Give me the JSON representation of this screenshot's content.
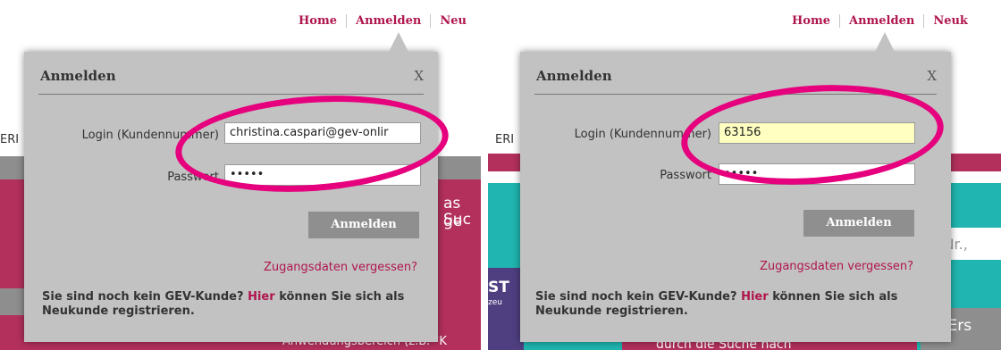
{
  "colors": {
    "accent": "#b0164e",
    "highlight_ring": "#e6007e",
    "dialog_bg": "#c2c2c2",
    "button_bg": "#8f8f8f"
  },
  "left": {
    "nav": [
      "Home",
      "Anmelden",
      "Neu"
    ],
    "bg_text": {
      "edge": "ERI",
      "s1": "as ge",
      "s2": "Suc",
      "bottom": "Anwendungsbereich (z.B. \"K"
    },
    "dialog": {
      "title": "Anmelden",
      "close_label": "X",
      "login_label": "Login (Kundennummer)",
      "login_value": "christina.caspari@gev-onlir",
      "password_label": "Passwort",
      "password_value": "•••••",
      "submit_label": "Anmelden",
      "forgot_label": "Zugangsdaten vergessen?",
      "note_prefix": "Sie sind noch kein GEV-Kunde?",
      "note_link": "Hier",
      "note_suffix": "können Sie sich als Neukunde registrieren."
    }
  },
  "right": {
    "nav": [
      "Home",
      "Anmelden",
      "Neuk"
    ],
    "bg_text": {
      "edge": "ERI",
      "st": "ST",
      "zeug": "zeu",
      "mnr": "M-Nr.,",
      "ers": "te Ers",
      "bottom": "durch die Suche nach"
    },
    "dialog": {
      "title": "Anmelden",
      "close_label": "X",
      "login_label": "Login (Kundennummer)",
      "login_value": "63156",
      "password_label": "Passwort",
      "password_value": "•••••",
      "submit_label": "Anmelden",
      "forgot_label": "Zugangsdaten vergessen?",
      "note_prefix": "Sie sind noch kein GEV-Kunde?",
      "note_link": "Hier",
      "note_suffix": "können Sie sich als Neukunde registrieren."
    }
  }
}
